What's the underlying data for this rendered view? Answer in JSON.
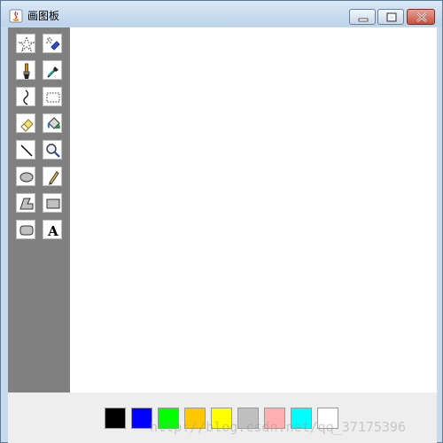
{
  "window": {
    "title": "画图板",
    "controls": {
      "minimize": "minimize",
      "maximize": "maximize",
      "close": "close"
    }
  },
  "toolbar": {
    "background": "#808080",
    "tools": [
      {
        "name": "free-select",
        "icon": "star-lasso-icon"
      },
      {
        "name": "airbrush",
        "icon": "airbrush-icon"
      },
      {
        "name": "brush",
        "icon": "brush-icon"
      },
      {
        "name": "color-picker",
        "icon": "eyedropper-icon"
      },
      {
        "name": "curve",
        "icon": "curve-icon"
      },
      {
        "name": "rect-select",
        "icon": "dotted-rect-icon"
      },
      {
        "name": "eraser",
        "icon": "eraser-icon"
      },
      {
        "name": "fill",
        "icon": "paint-bucket-icon"
      },
      {
        "name": "line",
        "icon": "line-icon"
      },
      {
        "name": "magnifier",
        "icon": "magnifier-icon"
      },
      {
        "name": "ellipse",
        "icon": "ellipse-icon"
      },
      {
        "name": "pencil",
        "icon": "pencil-icon"
      },
      {
        "name": "polygon",
        "icon": "polygon-icon"
      },
      {
        "name": "rectangle",
        "icon": "rectangle-icon"
      },
      {
        "name": "rounded-rectangle",
        "icon": "rounded-rect-icon"
      },
      {
        "name": "text",
        "icon": "text-icon",
        "glyph": "A"
      }
    ]
  },
  "palette": {
    "colors": [
      "#000000",
      "#0000ff",
      "#00ff00",
      "#ffc800",
      "#ffff00",
      "#c0c0c0",
      "#ffafaf",
      "#00ffff",
      "#ffffff"
    ]
  },
  "watermark": "http://blog.csdn.net/qq_37175396"
}
